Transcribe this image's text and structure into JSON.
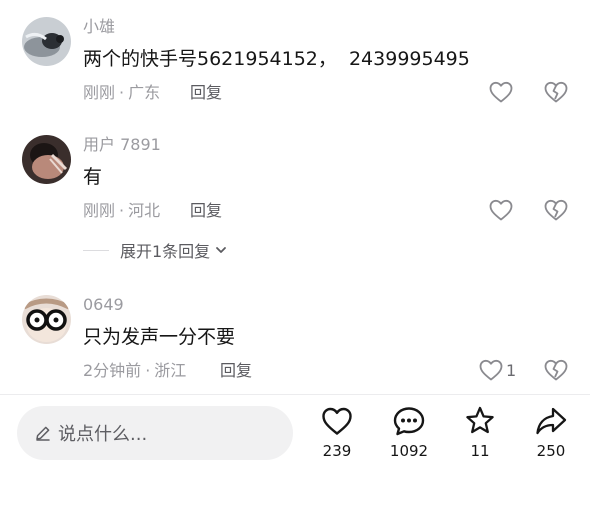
{
  "comments": [
    {
      "username": "小雄",
      "content": "两个的快手号5621954152，  2439995495",
      "time": "刚刚",
      "location": "广东",
      "reply_label": "回复",
      "like_count": ""
    },
    {
      "username": "用户 7891",
      "content": "有",
      "time": "刚刚",
      "location": "河北",
      "reply_label": "回复",
      "like_count": "",
      "expand_label": "展开1条回复"
    },
    {
      "username": "0649",
      "content": "只为发声一分不要",
      "time": "2分钟前",
      "location": "浙江",
      "reply_label": "回复",
      "like_count": "1"
    }
  ],
  "meta_separator": "·",
  "composer": {
    "placeholder": "说点什么..."
  },
  "actions": {
    "like_count": "239",
    "comment_count": "1092",
    "favorite_count": "11",
    "share_count": "250"
  },
  "icons": {
    "like": "heart-outline-icon",
    "dislike": "broken-heart-icon",
    "expand": "chevron-down-icon",
    "composer": "pencil-icon",
    "comment": "speech-bubble-icon",
    "favorite": "star-icon",
    "share": "share-arrow-icon"
  },
  "colors": {
    "text_primary": "#161616",
    "text_secondary": "#9b9ba0",
    "input_bg": "#f1f1f2"
  }
}
